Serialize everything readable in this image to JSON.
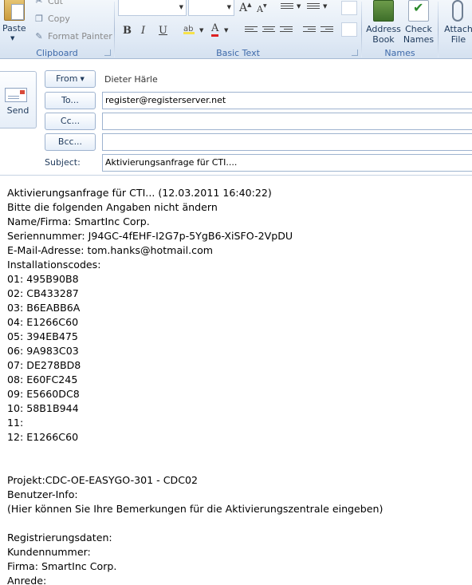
{
  "ribbon": {
    "clipboard": {
      "group_label": "Clipboard",
      "paste_label": "Paste",
      "cut_label": "Cut",
      "copy_label": "Copy",
      "format_painter_label": "Format Painter"
    },
    "basic_text": {
      "group_label": "Basic Text",
      "bold": "B",
      "italic": "I",
      "underline": "U",
      "grow_font": "A",
      "shrink_font": "A",
      "font_color": "A"
    },
    "names": {
      "group_label": "Names",
      "address_book_label": "Address Book",
      "address_book_line1": "Address",
      "address_book_line2": "Book",
      "check_names_line1": "Check",
      "check_names_line2": "Names"
    },
    "attach": {
      "line1": "Attach",
      "line2": "File"
    }
  },
  "header": {
    "send_label": "Send",
    "from_label": "From",
    "from_value": "Dieter Härle",
    "to_label": "To...",
    "to_value": "register@registerserver.net",
    "cc_label": "Cc...",
    "cc_value": "",
    "bcc_label": "Bcc...",
    "bcc_value": "",
    "subject_label": "Subject:",
    "subject_value": "Aktivierungsanfrage für CTI...."
  },
  "body": {
    "lines": [
      "Aktivierungsanfrage für CTI... (12.03.2011 16:40:22)",
      "Bitte die folgenden Angaben nicht ändern",
      "Name/Firma: SmartInc Corp.",
      "Seriennummer: J94GC-4fEHF-I2G7p-5YgB6-XiSFO-2VpDU",
      "E-Mail-Adresse: tom.hanks@hotmail.com",
      "Installationscodes:",
      "01: 495B90B8",
      "02: CB433287",
      "03: B6EABB6A",
      "04: E1266C60",
      "05: 394EB475",
      "06: 9A983C03",
      "07: DE278BD8",
      "08: E60FC245",
      "09: E5660DC8",
      "10: 58B1B944",
      "11:",
      "12: E1266C60",
      "",
      "",
      "Projekt:CDC-OE-EASYGO-301 - CDC02",
      "Benutzer-Info:",
      "(Hier können Sie Ihre Bemerkungen für die Aktivierungszentrale eingeben)",
      "",
      "Registrierungsdaten:",
      "Kundennummer:",
      "Firma: SmartInc Corp.",
      "Anrede:"
    ]
  },
  "colors": {
    "ribbon_bg": "#dfe9f5",
    "ribbon_text": "#1e395b",
    "group_label": "#3e6aaa",
    "field_border": "#9eb3cf",
    "body_text": "#000000"
  }
}
